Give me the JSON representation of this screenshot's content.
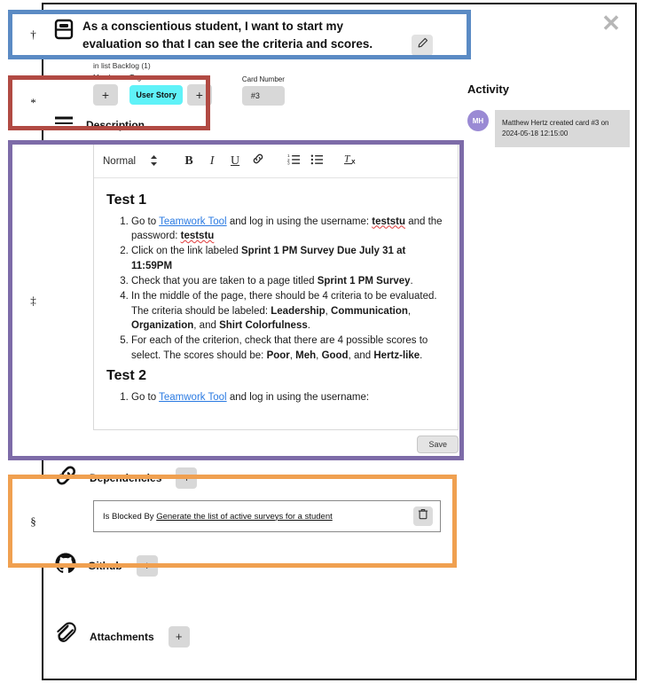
{
  "modal": {
    "close_icon": "close-icon",
    "card_icon": "card-icon",
    "title": "As a conscientious student, I want to start my evaluation so that I can see the criteria and scores.",
    "edit_icon": "pencil-icon",
    "in_list": "in list Backlog (1)"
  },
  "meta": {
    "members_label": "Members",
    "members_add": "+",
    "tags_label": "Tags",
    "tag": "User Story",
    "tags_add": "+",
    "card_number_label": "Card Number",
    "card_number": "#3"
  },
  "description": {
    "icon": "description-lines-icon",
    "heading": "Description",
    "toolbar": {
      "style": "Normal",
      "style_caret": "↕",
      "bold": "B",
      "italic": "I",
      "underline": "U",
      "link_icon": "link-icon",
      "ordered_list_icon": "ordered-list-icon",
      "bullet_list_icon": "bullet-list-icon",
      "clear_format": "Tx"
    },
    "save_label": "Save",
    "content": {
      "test1_heading": "Test 1",
      "test1_items": [
        "Go to |Teamwork Tool| and log in using the username: *teststu* and the password: *teststu*",
        "Click on the link labeled **Sprint 1 PM Survey Due July 31 at 11:59PM**",
        "Check that you are taken to a page titled **Sprint 1 PM Survey**.",
        "In the middle of the page, there should be 4 criteria to be evaluated. The criteria should be labeled: **Leadership**, **Communication**, **Organization**, and **Shirt Colorfulness**.",
        "For each of the criterion, check that there are 4 possible scores to select. The scores should be: **Poor**, **Meh**, **Good**, and **Hertz-like**."
      ],
      "test2_heading": "Test 2",
      "test2_items": [
        "Go to |Teamwork Tool| and log in using the username:"
      ],
      "link_text": "Teamwork Tool"
    }
  },
  "dependencies": {
    "icon": "link-chain-icon",
    "heading": "Dependencies",
    "add": "+",
    "item_prefix": "Is Blocked By",
    "item_link": "Generate the list of active surveys for a student",
    "delete_icon": "trash-icon"
  },
  "github": {
    "icon": "github-icon",
    "heading": "Github",
    "add": "+"
  },
  "attachments": {
    "icon": "paperclip-icon",
    "heading": "Attachments",
    "add": "+"
  },
  "activity": {
    "title": "Activity",
    "items": [
      {
        "initials": "MH",
        "text": "Matthew Hertz created card #3 on 2024-05-18 12:15:00"
      }
    ]
  },
  "annotations": [
    {
      "marker": "†",
      "color": "#5b8bc4",
      "target": "card-title"
    },
    {
      "marker": "*",
      "color": "#b14a43",
      "target": "members-tags"
    },
    {
      "marker": "‡",
      "color": "#7d6ba8",
      "target": "description-editor"
    },
    {
      "marker": "§",
      "color": "#f0a050",
      "target": "dependencies"
    }
  ]
}
